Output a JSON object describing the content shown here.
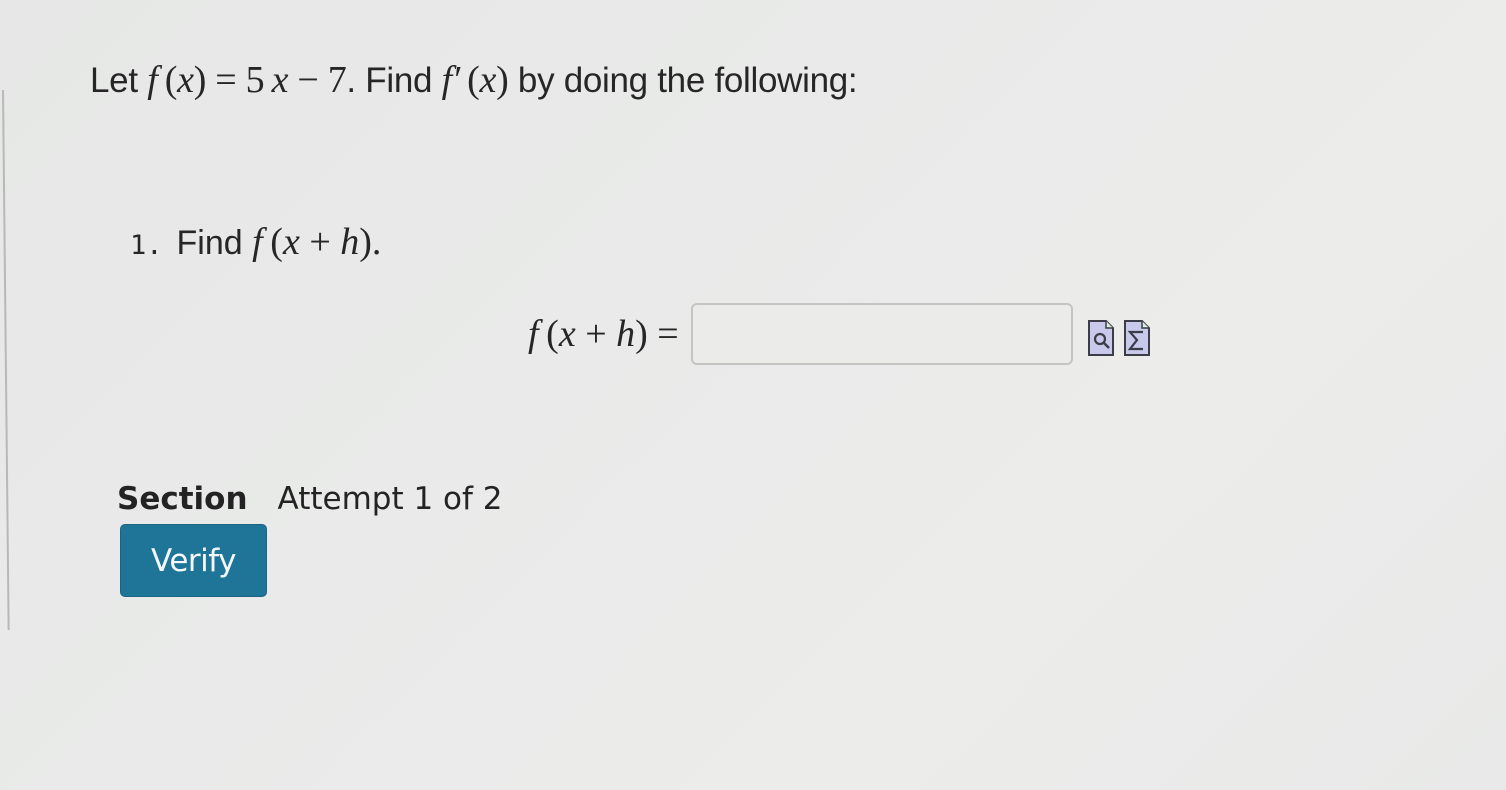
{
  "question": {
    "prefix": "Let ",
    "function_def": {
      "name": "f",
      "var": "x",
      "rhs_coef": "5",
      "rhs_var": "x",
      "rhs_const": "7"
    },
    "find_label": ". Find ",
    "derivative": {
      "name": "f′",
      "var": "x"
    },
    "suffix": " by doing the following:"
  },
  "steps": [
    {
      "number": "1.",
      "text": "Find ",
      "expression": {
        "name": "f",
        "var1": "x",
        "var2": "h"
      },
      "end": "."
    }
  ],
  "answer": {
    "label": {
      "name": "f",
      "var1": "x",
      "var2": "h"
    },
    "value": "",
    "placeholder": "",
    "tools": [
      {
        "name": "preview-icon",
        "symbol": "magnifier"
      },
      {
        "name": "equation-editor-icon",
        "symbol": "Σ"
      }
    ]
  },
  "section": {
    "label": "Section",
    "attempt_text": "Attempt 1 of 2"
  },
  "verify_button": {
    "label": "Verify",
    "color": "#1f7598"
  }
}
